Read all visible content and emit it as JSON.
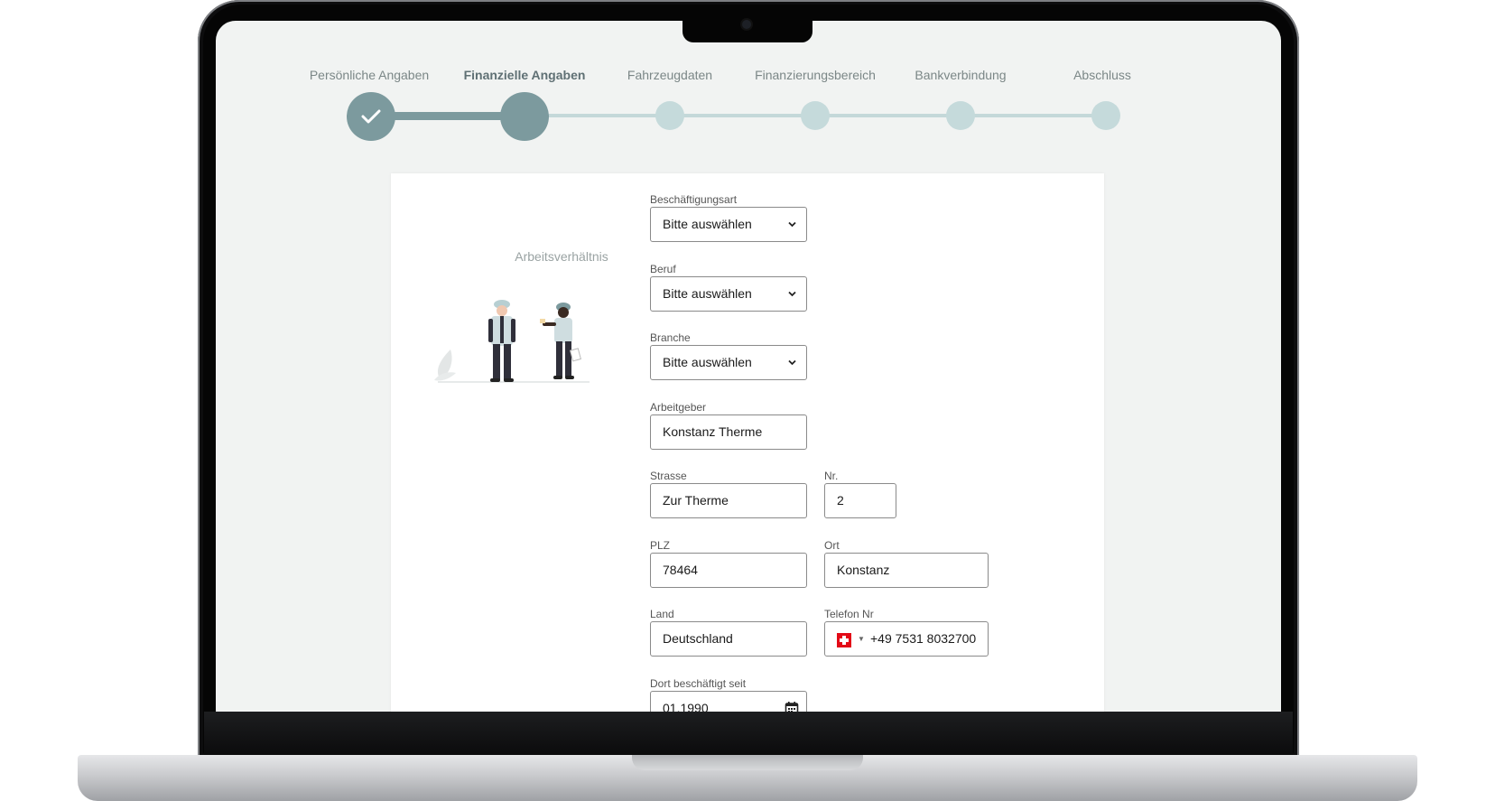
{
  "stepper": {
    "steps": [
      {
        "label": "Persönliche Angaben",
        "state": "done"
      },
      {
        "label": "Finanzielle Angaben",
        "state": "active"
      },
      {
        "label": "Fahrzeugdaten",
        "state": "pending"
      },
      {
        "label": "Finanzierungsbereich",
        "state": "pending"
      },
      {
        "label": "Bankverbindung",
        "state": "pending"
      },
      {
        "label": "Abschluss",
        "state": "pending"
      }
    ]
  },
  "section": {
    "title": "Arbeitsverhältnis"
  },
  "form": {
    "employment_type": {
      "label": "Beschäftigungsart",
      "value": "Bitte auswählen"
    },
    "profession": {
      "label": "Beruf",
      "value": "Bitte auswählen"
    },
    "industry": {
      "label": "Branche",
      "value": "Bitte auswählen"
    },
    "employer": {
      "label": "Arbeitgeber",
      "value": "Konstanz Therme"
    },
    "street": {
      "label": "Strasse",
      "value": "Zur Therme"
    },
    "number": {
      "label": "Nr.",
      "value": "2"
    },
    "zip": {
      "label": "PLZ",
      "value": "78464"
    },
    "city": {
      "label": "Ort",
      "value": "Konstanz"
    },
    "country": {
      "label": "Land",
      "value": "Deutschland"
    },
    "phone": {
      "label": "Telefon Nr",
      "value": "+49 7531 8032700",
      "flag": "swiss-flag-icon"
    },
    "employed_since": {
      "label": "Dort beschäftigt seit",
      "value": "01.1990"
    }
  },
  "colors": {
    "accent": "#7c9a9e",
    "pending": "#c5dadb",
    "screen_bg": "#f1f3f2"
  }
}
